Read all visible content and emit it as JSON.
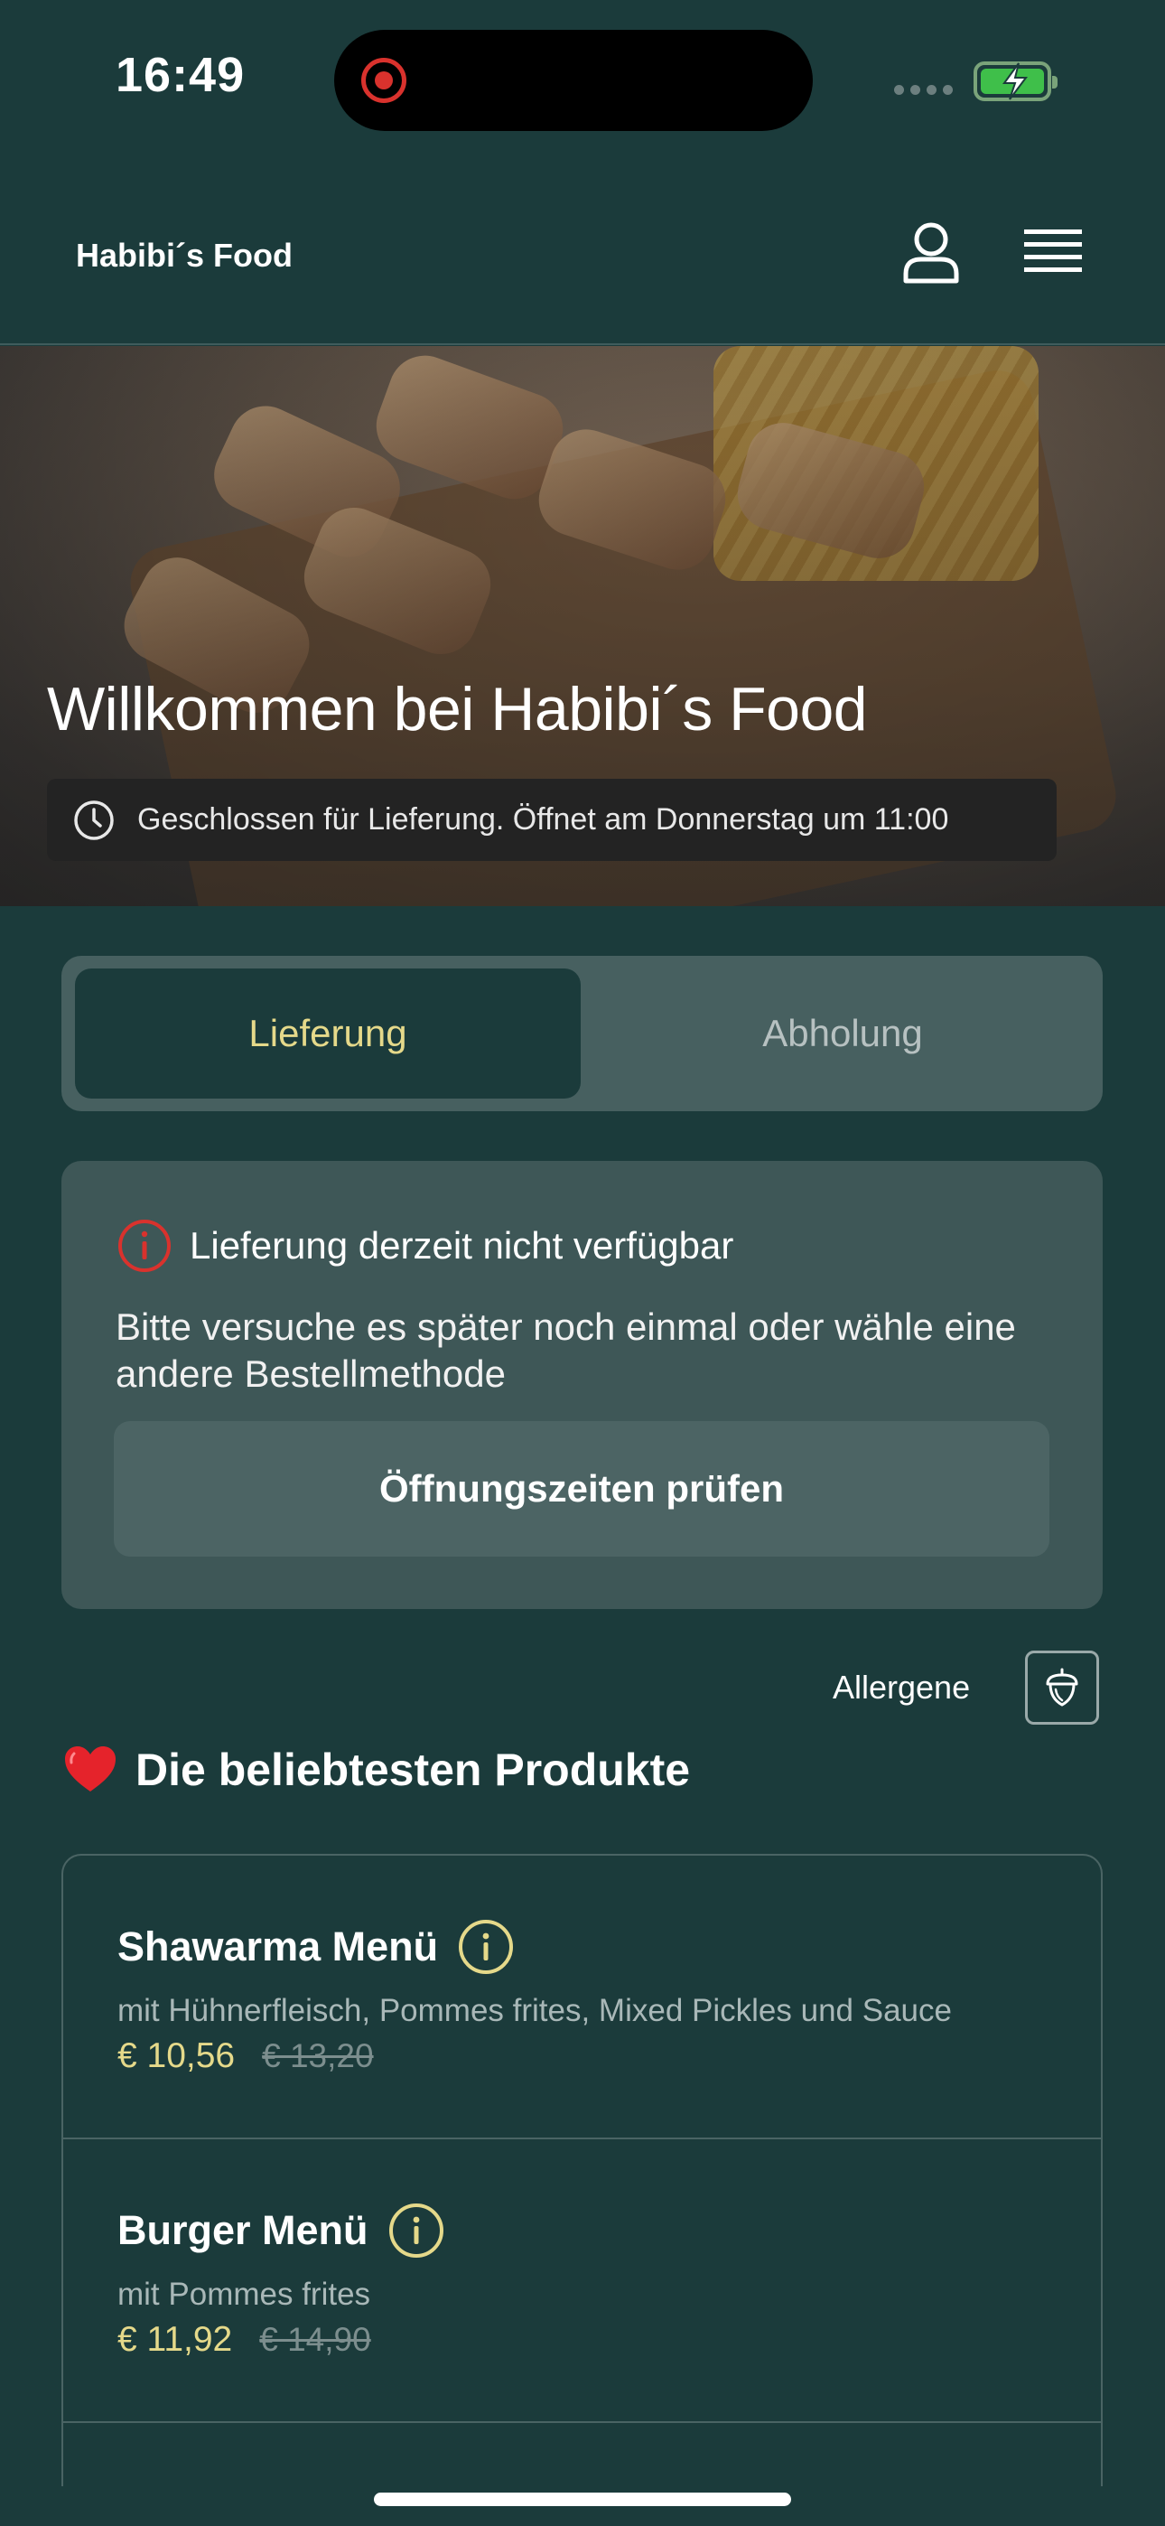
{
  "status_bar": {
    "time": "16:49"
  },
  "header": {
    "brand": "Habibi´s Food",
    "icons": [
      "user-icon",
      "hamburger-menu-icon"
    ]
  },
  "hero": {
    "title": "Willkommen bei Habibi´s Food",
    "closed_notice": "Geschlossen für Lieferung. Öffnet am Donnerstag um 11:00"
  },
  "tabs": [
    {
      "label": "Lieferung",
      "active": true
    },
    {
      "label": "Abholung",
      "active": false
    }
  ],
  "notice": {
    "title": "Lieferung derzeit nicht verfügbar",
    "body": "Bitte versuche es später noch einmal oder wähle eine andere Bestellmethode",
    "button": "Öffnungszeiten prüfen"
  },
  "allergens": {
    "label": "Allergene"
  },
  "popular": {
    "title": "Die beliebtesten Produkte",
    "products": [
      {
        "name": "Shawarma Menü",
        "description": "mit Hühnerfleisch, Pommes frites, Mixed Pickles und Sauce",
        "price": "€ 10,56",
        "old_price": "€ 13,20"
      },
      {
        "name": "Burger Menü",
        "description": "mit Pommes frites",
        "price": "€ 11,92",
        "old_price": "€ 14,90"
      }
    ]
  },
  "colors": {
    "background": "#1b3b3b",
    "accent": "#e5d98a",
    "error": "#d9322d",
    "card": "#3e5757"
  }
}
